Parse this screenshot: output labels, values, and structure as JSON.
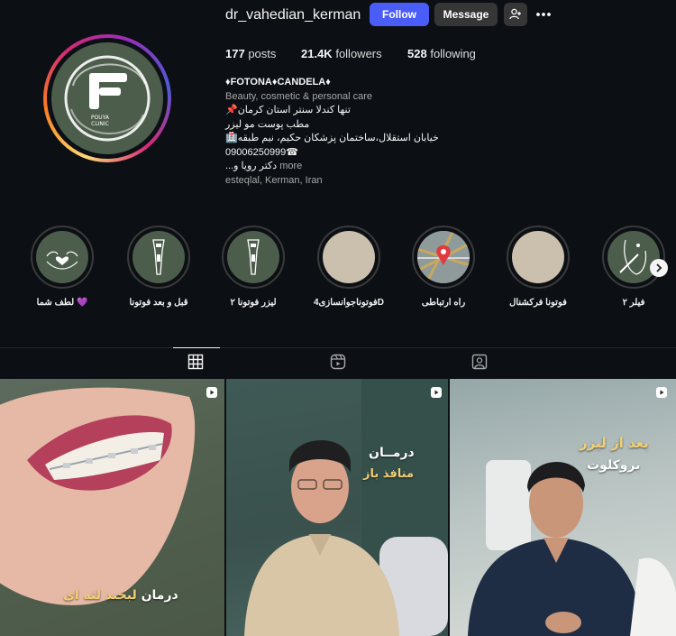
{
  "profile": {
    "username": "dr_vahedian_kerman",
    "follow_label": "Follow",
    "message_label": "Message",
    "avatar_text": "POUYA CLINIC",
    "stats": {
      "posts_count": "177",
      "posts_label": "posts",
      "followers_count": "21.4K",
      "followers_label": "followers",
      "following_count": "528",
      "following_label": "following"
    },
    "bio": {
      "name": "♦FOTONA♦CANDELA♦",
      "category": "Beauty, cosmetic & personal care",
      "line1": "📌تنها کندلا سنتر استان کرمان",
      "line2": "مطب پوست مو لیزر",
      "line3": "🏥خیابان استقلال،ساختمان پزشکان حکیم، نیم طبقه",
      "line4": "09006250999☎",
      "line5_text": "...دکتر رویا و",
      "more_label": "more",
      "location": "esteqlal, Kerman, Iran"
    }
  },
  "highlights": [
    {
      "label": "لطف شما 💜",
      "icon": "heart-hands-icon"
    },
    {
      "label": "قبل و بعد فوتونا",
      "icon": "laser-handpiece-icon"
    },
    {
      "label": "لیزر فوتونا ۲",
      "icon": "laser-handpiece-icon"
    },
    {
      "label": "فوتوناجوانسازی4D",
      "icon": "blank-cover"
    },
    {
      "label": "راه ارتباطی",
      "icon": "map-pin-icon"
    },
    {
      "label": "فوتونا فرکشنال",
      "icon": "blank-cover"
    },
    {
      "label": "فیلر ۲",
      "icon": "face-outline-icon"
    }
  ],
  "tabs": [
    {
      "name": "posts",
      "icon": "grid-icon",
      "active": true
    },
    {
      "name": "reels",
      "icon": "reels-icon",
      "active": false
    },
    {
      "name": "tagged",
      "icon": "tagged-icon",
      "active": false
    }
  ],
  "posts": [
    {
      "caption_white": "درمان ",
      "caption_accent": "لبخند لثه ای",
      "type": "reel"
    },
    {
      "caption_line1": "درمــان",
      "caption_line2": "منافذ باز",
      "type": "reel"
    },
    {
      "caption_line1": "بعد از لیزر",
      "caption_line2": "بروکلوت",
      "type": "reel"
    }
  ],
  "colors": {
    "background": "#0c0f14",
    "follow_button": "#4a5df9",
    "secondary_button": "#363636",
    "accent_caption": "#f3cf74"
  }
}
